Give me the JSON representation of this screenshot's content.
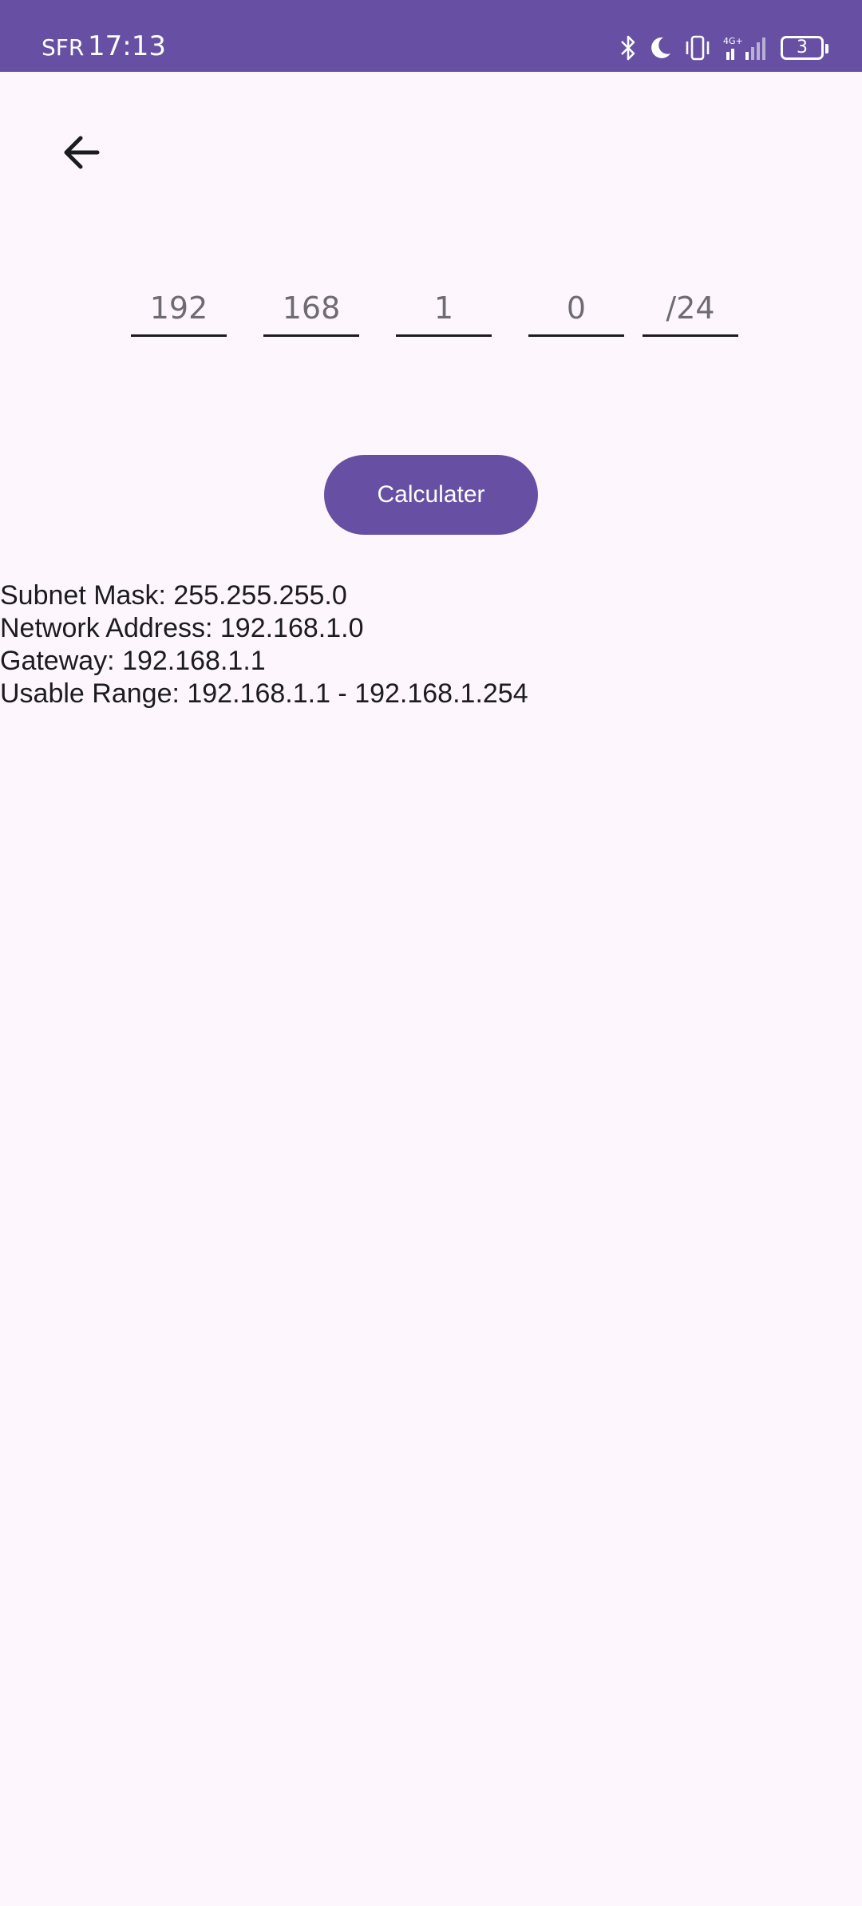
{
  "status_bar": {
    "carrier": "SFR",
    "time": "17:13",
    "battery_level": "3",
    "network_label": "4G+",
    "icons": [
      "bluetooth-icon",
      "moon-icon",
      "vibrate-icon",
      "signal-icon",
      "battery-icon"
    ]
  },
  "toolbar": {
    "back_icon": "arrow-left-icon"
  },
  "ip_inputs": {
    "octet1_placeholder": "192",
    "octet2_placeholder": "168",
    "octet3_placeholder": "1",
    "octet4_placeholder": "0",
    "cidr_placeholder": "/24"
  },
  "calculate_button": {
    "label": "Calculater",
    "color": "#6750a4"
  },
  "results": {
    "subnet_mask": "Subnet Mask: 255.255.255.0",
    "network_address": "Network Address: 192.168.1.0",
    "gateway": "Gateway: 192.168.1.1",
    "usable_range": "Usable Range: 192.168.1.1 - 192.168.1.254"
  },
  "colors": {
    "accent": "#6750a4",
    "background": "#fdf7fd",
    "text": "#1c1b1f"
  }
}
